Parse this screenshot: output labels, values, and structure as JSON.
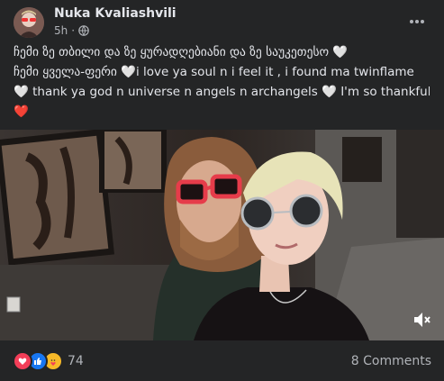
{
  "post": {
    "author": "Nuka Kvaliashvili",
    "time": "5h",
    "privacy_icon": "globe-icon",
    "more_icon": "more-options-icon",
    "text_lines": [
      "ჩემი ზე თბილი და ზე ყურადღებიანი და ზე საუკეთესო",
      "ჩემი ყველა-ფერი",
      "i love ya soul n i feel it , i found ma twinflame",
      "thank ya god n universe n angels n archangels",
      "I'm so thankful"
    ],
    "hearts": {
      "white": "🤍",
      "red": "❤️"
    },
    "media": {
      "mute_icon": "volume-muted-icon"
    },
    "reactions": {
      "types": [
        "love",
        "like",
        "care"
      ],
      "count": "74",
      "colors": {
        "love": "#f33e58",
        "like": "#1877f2",
        "care": "#f7b928"
      }
    },
    "comments_label": "8 Comments"
  }
}
